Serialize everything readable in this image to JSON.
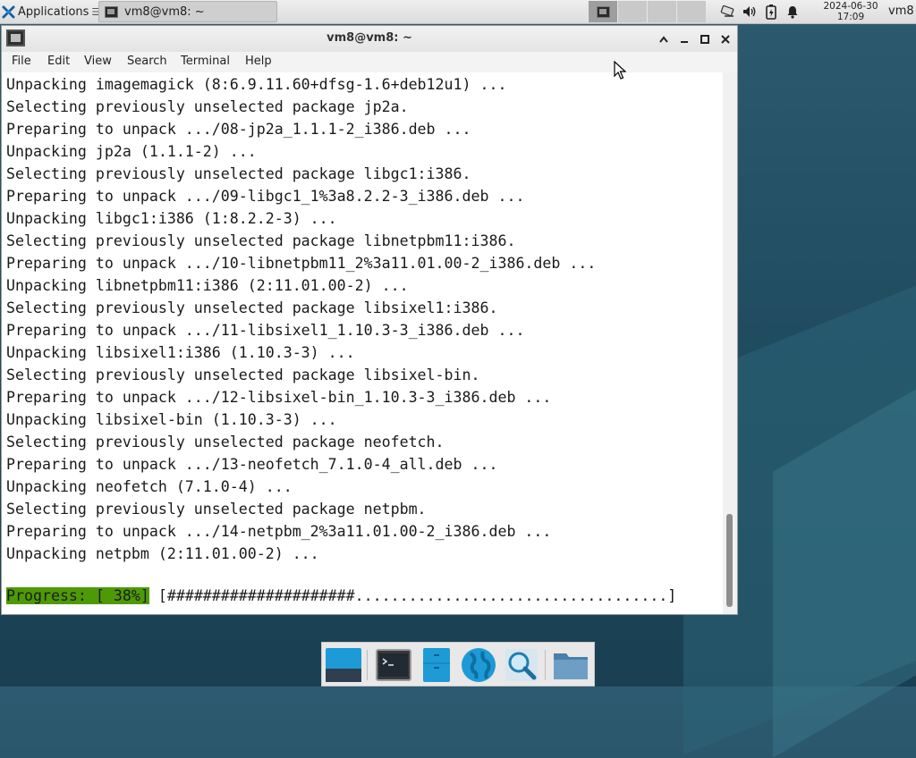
{
  "colors": {
    "desktop_bg": "#1f4a5e",
    "progress_bg": "#4e9a06",
    "panel_bg": "#e4e4e4"
  },
  "top_panel": {
    "applications_label": "Applications",
    "applications_icon": "xfce-mouse-icon",
    "task": {
      "title": "vm8@vm8: ~",
      "icon": "terminal-icon"
    },
    "workspaces": [
      {
        "active": true,
        "icon": "terminal-icon"
      },
      {
        "active": false
      },
      {
        "active": false
      },
      {
        "active": false
      }
    ],
    "tray_icons": [
      "network-icon",
      "volume-icon",
      "battery-icon",
      "notification-bell-icon"
    ],
    "clock": {
      "date": "2024-06-30",
      "time": "17:09"
    },
    "user": "vm8"
  },
  "window": {
    "title": "vm8@vm8: ~",
    "controls": [
      "shade-up-icon",
      "minimize-icon",
      "maximize-icon",
      "close-icon"
    ],
    "menu": [
      "File",
      "Edit",
      "View",
      "Search",
      "Terminal",
      "Help"
    ],
    "terminal_lines": [
      "Unpacking imagemagick (8:6.9.11.60+dfsg-1.6+deb12u1) ...",
      "Selecting previously unselected package jp2a.",
      "Preparing to unpack .../08-jp2a_1.1.1-2_i386.deb ...",
      "Unpacking jp2a (1.1.1-2) ...",
      "Selecting previously unselected package libgc1:i386.",
      "Preparing to unpack .../09-libgc1_1%3a8.2.2-3_i386.deb ...",
      "Unpacking libgc1:i386 (1:8.2.2-3) ...",
      "Selecting previously unselected package libnetpbm11:i386.",
      "Preparing to unpack .../10-libnetpbm11_2%3a11.01.00-2_i386.deb ...",
      "Unpacking libnetpbm11:i386 (2:11.01.00-2) ...",
      "Selecting previously unselected package libsixel1:i386.",
      "Preparing to unpack .../11-libsixel1_1.10.3-3_i386.deb ...",
      "Unpacking libsixel1:i386 (1.10.3-3) ...",
      "Selecting previously unselected package libsixel-bin.",
      "Preparing to unpack .../12-libsixel-bin_1.10.3-3_i386.deb ...",
      "Unpacking libsixel-bin (1.10.3-3) ...",
      "Selecting previously unselected package neofetch.",
      "Preparing to unpack .../13-neofetch_7.1.0-4_all.deb ...",
      "Unpacking neofetch (7.1.0-4) ...",
      "Selecting previously unselected package netpbm.",
      "Preparing to unpack .../14-netpbm_2%3a11.01.00-2_i386.deb ...",
      "Unpacking netpbm (2:11.01.00-2) ..."
    ],
    "progress": {
      "label": "Progress: [ 38%]",
      "bar": "[#####################...................................]",
      "percent": 38
    },
    "scroll_position": 0.92
  },
  "dock": {
    "items": [
      {
        "name": "show-desktop-icon"
      },
      {
        "name": "terminal-icon"
      },
      {
        "name": "file-manager-icon"
      },
      {
        "name": "web-browser-icon"
      },
      {
        "name": "app-finder-icon"
      },
      {
        "name": "home-folder-icon"
      }
    ]
  }
}
